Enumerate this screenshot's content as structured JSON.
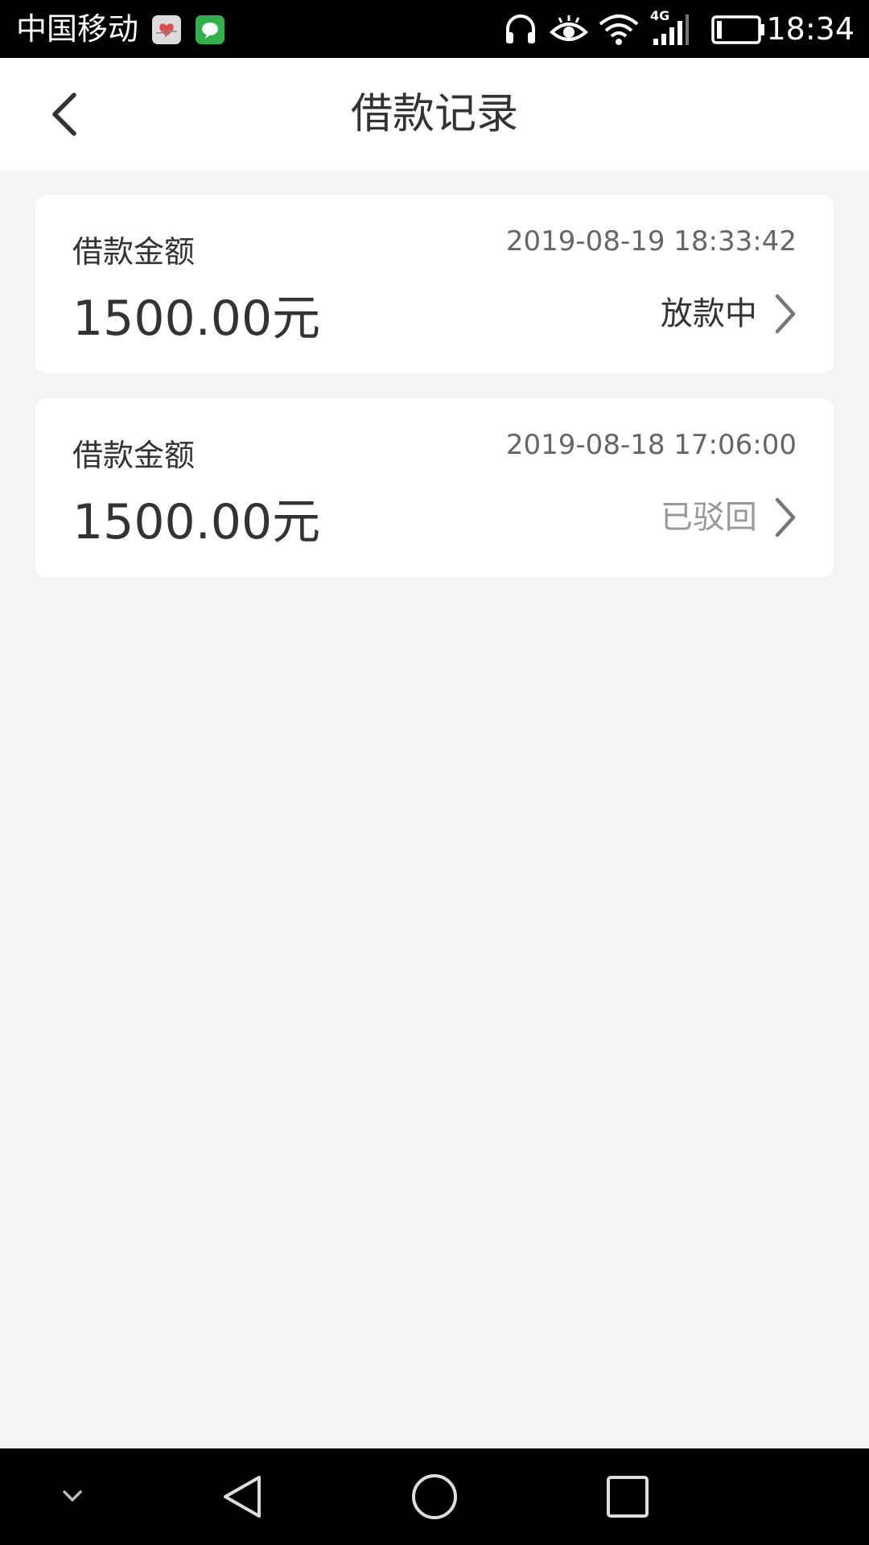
{
  "status_bar": {
    "carrier": "中国移动",
    "time": "18:34",
    "network": "4G",
    "icons": [
      "health-app-icon",
      "message-app-icon",
      "headphones-icon",
      "eye-icon",
      "wifi-icon",
      "signal-icon",
      "battery-icon"
    ]
  },
  "header": {
    "title": "借款记录",
    "back_icon": "back-arrow-icon"
  },
  "records": [
    {
      "label": "借款金额",
      "date": "2019-08-19 18:33:42",
      "amount": "1500.00元",
      "status": "放款中",
      "status_color": "#333333"
    },
    {
      "label": "借款金额",
      "date": "2019-08-18 17:06:00",
      "amount": "1500.00元",
      "status": "已驳回",
      "status_color": "#999999"
    }
  ],
  "nav_bar": {
    "icons": [
      "hide-keyboard-icon",
      "nav-back-icon",
      "nav-home-icon",
      "nav-recents-icon"
    ]
  },
  "colors": {
    "background": "#f4f4f4",
    "card": "#ffffff",
    "text_primary": "#333333",
    "text_secondary": "#666666",
    "text_muted": "#999999"
  }
}
